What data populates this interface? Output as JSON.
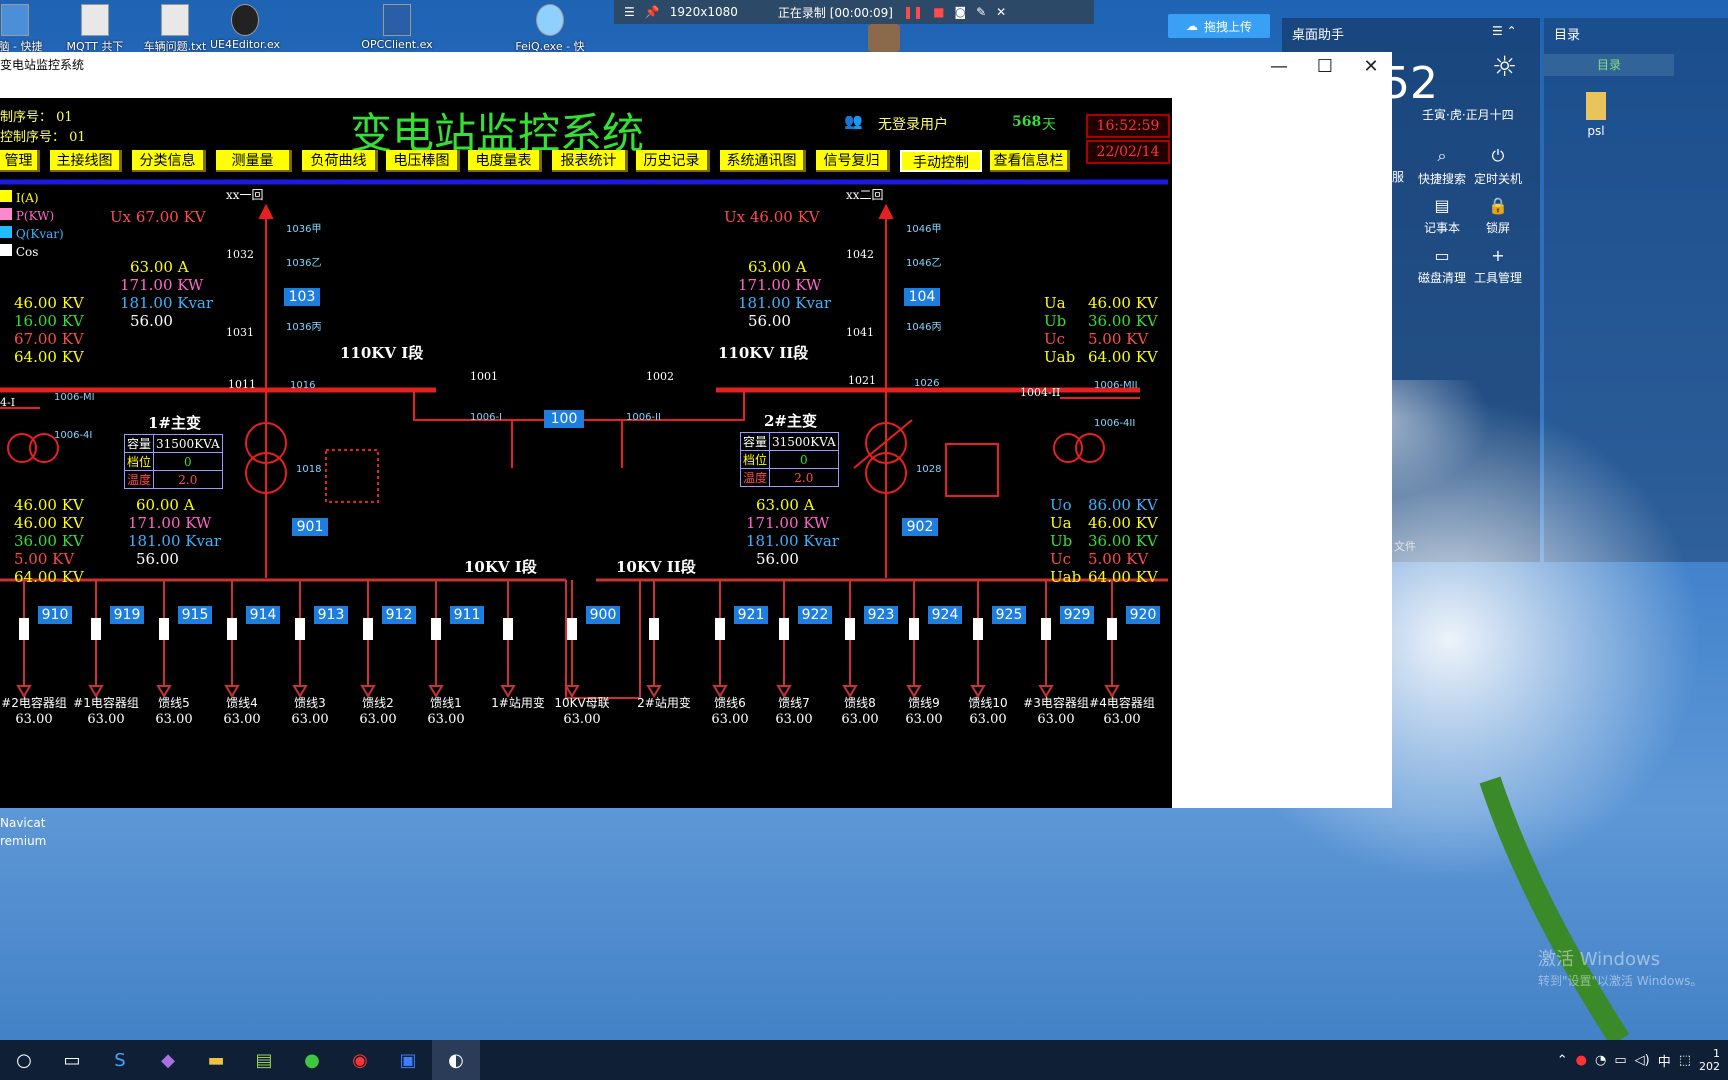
{
  "desktop": {
    "icons": [
      {
        "label": "电脑 - 快捷",
        "glyph": "🖥"
      },
      {
        "label": "MQTT 共下",
        "glyph": "📄"
      },
      {
        "label": "车辆问题.txt",
        "glyph": "📄"
      },
      {
        "label": "UE4Editor.ex",
        "glyph": "⚙"
      },
      {
        "label": "OPCClient.ex",
        "glyph": "🖥"
      },
      {
        "label": "FeiQ.exe - 快",
        "glyph": "☁"
      }
    ],
    "navicat_label": "Navicat\nremium",
    "watermark_1": "激活 Windows",
    "watermark_2": "转到\"设置\"以激活 Windows。"
  },
  "recorder": {
    "resolution": "1920x1080",
    "status": "正在录制 [00:00:09]"
  },
  "upload_button": "拖拽上传",
  "helper": {
    "title": "桌面助手",
    "time": "52",
    "lunar": "壬寅·虎·正月十四",
    "buttons": [
      {
        "label": "快捷搜索",
        "glyph": "⌕"
      },
      {
        "label": "定时关机",
        "glyph": "⏻"
      },
      {
        "label": "记事本",
        "glyph": "▤"
      },
      {
        "label": "锁屏",
        "glyph": "🔒"
      },
      {
        "label": "磁盘清理",
        "glyph": "▭"
      },
      {
        "label": "工具管理",
        "glyph": "+"
      }
    ],
    "partial_1": "服",
    "partial_2": "文件"
  },
  "catalog": {
    "title": "目录",
    "tab": "目录",
    "item": "psl"
  },
  "window": {
    "title": "变电站监控系统",
    "min": "—",
    "max": "☐",
    "close": "✕"
  },
  "scada": {
    "serial": "制序号： 01",
    "ctrl_serial": "控制序号： 01",
    "title": "变电站监控系统",
    "user": "无登录用户",
    "days_value": "568",
    "days_unit": "天",
    "clock_time": "16:52:59",
    "clock_date": "22/02/14",
    "menu": [
      "管理",
      "主接线图",
      "分类信息",
      "测量量",
      "负荷曲线",
      "电压棒图",
      "电度量表",
      "报表统计",
      "历史记录",
      "系统通讯图",
      "信号复归",
      "手动控制",
      "查看信息栏"
    ],
    "legend": [
      {
        "label": "I(A)",
        "color": "#ffff00"
      },
      {
        "label": "P(KW)",
        "color": "#ff88cc"
      },
      {
        "label": "Q(Kvar)",
        "color": "#22bbff"
      },
      {
        "label": "Cos",
        "color": "#ffffff"
      }
    ],
    "line1": {
      "name": "xx一回",
      "ux": "Ux 67.00 KV",
      "a": "63.00 A",
      "kw": "171.00 KW",
      "kvar": "181.00 Kvar",
      "cos": "56.00",
      "sw": "103"
    },
    "line2": {
      "name": "xx二回",
      "ux": "Ux 46.00 KV",
      "a": "63.00 A",
      "kw": "171.00 KW",
      "kvar": "181.00 Kvar",
      "cos": "56.00",
      "sw": "104"
    },
    "left_volts": [
      "46.00 KV",
      "16.00 KV",
      "67.00 KV",
      "64.00 KV"
    ],
    "right_volts": [
      {
        "n": "Ua",
        "v": "46.00 KV"
      },
      {
        "n": "Ub",
        "v": "36.00 KV"
      },
      {
        "n": "Uc",
        "v": "5.00 KV"
      },
      {
        "n": "Uab",
        "v": "64.00 KV"
      }
    ],
    "bus110_1": "110KV I段",
    "bus110_2": "110KV II段",
    "t1": {
      "name": "1#主变",
      "cap_l": "容量",
      "cap": "31500KVA",
      "tap_l": "档位",
      "tap": "0",
      "temp_l": "温度",
      "temp": "2.0"
    },
    "t2": {
      "name": "2#主变",
      "cap_l": "容量",
      "cap": "31500KVA",
      "tap_l": "档位",
      "tap": "0",
      "temp_l": "温度",
      "temp": "2.0"
    },
    "t1_low": {
      "a": "60.00 A",
      "kw": "171.00 KW",
      "kvar": "181.00 Kvar",
      "cos": "56.00",
      "sw": "901"
    },
    "t2_low": {
      "a": "63.00 A",
      "kw": "171.00 KW",
      "kvar": "181.00 Kvar",
      "cos": "56.00",
      "sw": "902"
    },
    "left_low_volts": [
      "46.00 KV",
      "46.00 KV",
      "36.00 KV",
      "5.00 KV",
      "64.00 KV"
    ],
    "right_low_volts": [
      {
        "n": "Uo",
        "v": "86.00 KV"
      },
      {
        "n": "Ua",
        "v": "46.00 KV"
      },
      {
        "n": "Ub",
        "v": "36.00 KV"
      },
      {
        "n": "Uc",
        "v": "5.00 KV"
      },
      {
        "n": "Uab",
        "v": "64.00 KV"
      }
    ],
    "bus10_1": "10KV I段",
    "bus10_2": "10KV II段",
    "sw_labels": {
      "s1032": "1032",
      "s1031": "1031",
      "s1011": "1011",
      "s1042": "1042",
      "s1041": "1041",
      "s1021": "1021",
      "s1001": "1001",
      "s1002": "1002",
      "s100": "100",
      "s1006i": "1006-I",
      "s1006ii": "1006-II",
      "s1016": "1016",
      "s1018": "1018",
      "s1026": "1026",
      "s1028": "1028",
      "s1004i": "4-I",
      "s1004ii": "1004-II",
      "s1036a": "1036甲",
      "s1036b": "1036乙",
      "s1036c": "1036丙",
      "s1046a": "1046甲",
      "s1046b": "1046乙",
      "s1046c": "1046丙",
      "s1006mi": "1006-MI",
      "s1006_4i": "1006-4I",
      "s1006mii": "1006-MII",
      "s1006_4ii": "1006-4II"
    },
    "feeders": [
      {
        "sw": "910",
        "name": "#2电容器组",
        "val": "63.00"
      },
      {
        "sw": "919",
        "name": "#1电容器组",
        "val": "63.00"
      },
      {
        "sw": "915",
        "name": "馈线5",
        "val": "63.00"
      },
      {
        "sw": "914",
        "name": "馈线4",
        "val": "63.00"
      },
      {
        "sw": "913",
        "name": "馈线3",
        "val": "63.00"
      },
      {
        "sw": "912",
        "name": "馈线2",
        "val": "63.00"
      },
      {
        "sw": "911",
        "name": "馈线1",
        "val": "63.00"
      },
      {
        "sw": "",
        "name": "1#站用变",
        "val": ""
      },
      {
        "sw": "900",
        "name": "10KV母联",
        "val": "63.00"
      },
      {
        "sw": "",
        "name": "2#站用变",
        "val": ""
      },
      {
        "sw": "921",
        "name": "馈线6",
        "val": "63.00"
      },
      {
        "sw": "922",
        "name": "馈线7",
        "val": "63.00"
      },
      {
        "sw": "923",
        "name": "馈线8",
        "val": "63.00"
      },
      {
        "sw": "924",
        "name": "馈线9",
        "val": "63.00"
      },
      {
        "sw": "925",
        "name": "馈线10",
        "val": "63.00"
      },
      {
        "sw": "929",
        "name": "#3电容器组",
        "val": "63.00"
      },
      {
        "sw": "920",
        "name": "#4电容器组",
        "val": "63.00"
      }
    ]
  },
  "taskbar": {
    "ime": "中",
    "time_partial": "1",
    "date_partial": "202"
  }
}
